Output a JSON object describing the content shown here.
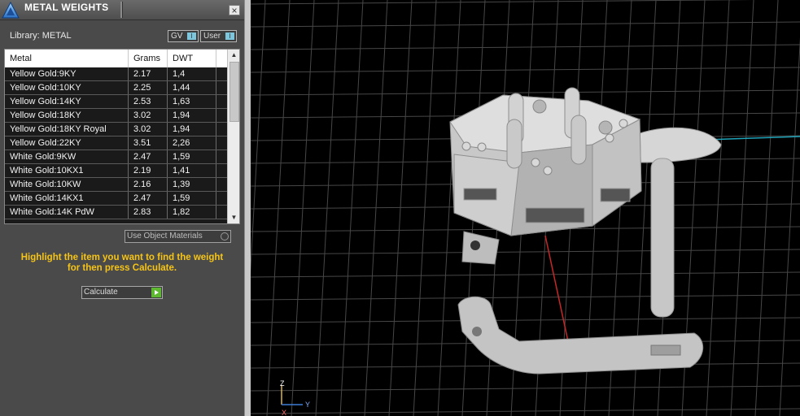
{
  "window": {
    "title": "METAL WEIGHTS",
    "close_label": "×",
    "logo_icon": "triangle-logo-icon"
  },
  "library": {
    "label": "Library: METAL",
    "toggle_gv": "GV",
    "toggle_user": "User",
    "toggle_indicator": "I"
  },
  "table": {
    "headers": [
      "Metal",
      "Grams",
      "DWT"
    ],
    "rows": [
      {
        "metal": "Yellow Gold:9KY",
        "grams": "2.17",
        "dwt": "1,4"
      },
      {
        "metal": "Yellow Gold:10KY",
        "grams": "2.25",
        "dwt": "1,44"
      },
      {
        "metal": "Yellow Gold:14KY",
        "grams": "2.53",
        "dwt": "1,63"
      },
      {
        "metal": "Yellow Gold:18KY",
        "grams": "3.02",
        "dwt": "1,94"
      },
      {
        "metal": "Yellow Gold:18KY Royal",
        "grams": "3.02",
        "dwt": "1,94"
      },
      {
        "metal": "Yellow Gold:22KY",
        "grams": "3.51",
        "dwt": "2,26"
      },
      {
        "metal": "White Gold:9KW",
        "grams": "2.47",
        "dwt": "1,59"
      },
      {
        "metal": "White Gold:10KX1",
        "grams": "2.19",
        "dwt": "1,41"
      },
      {
        "metal": "White Gold:10KW",
        "grams": "2.16",
        "dwt": "1,39"
      },
      {
        "metal": "White Gold:14KX1",
        "grams": "2.47",
        "dwt": "1,59"
      },
      {
        "metal": "White Gold:14K PdW",
        "grams": "2.83",
        "dwt": "1,82"
      }
    ]
  },
  "options": {
    "use_object_materials": "Use Object Materials"
  },
  "instructions": {
    "line1": "Highlight the item you want to find the weight",
    "line2": "for then press Calculate."
  },
  "actions": {
    "calculate_label": "Calculate"
  },
  "viewport": {
    "axis_z": "Z",
    "axis_y": "Y",
    "axis_x": "X",
    "colors": {
      "background": "#000000",
      "grid": "#4a4a4a",
      "axis_red": "#c62828",
      "axis_cyan": "#1fa3b8",
      "model": "#cfcfcf"
    }
  }
}
